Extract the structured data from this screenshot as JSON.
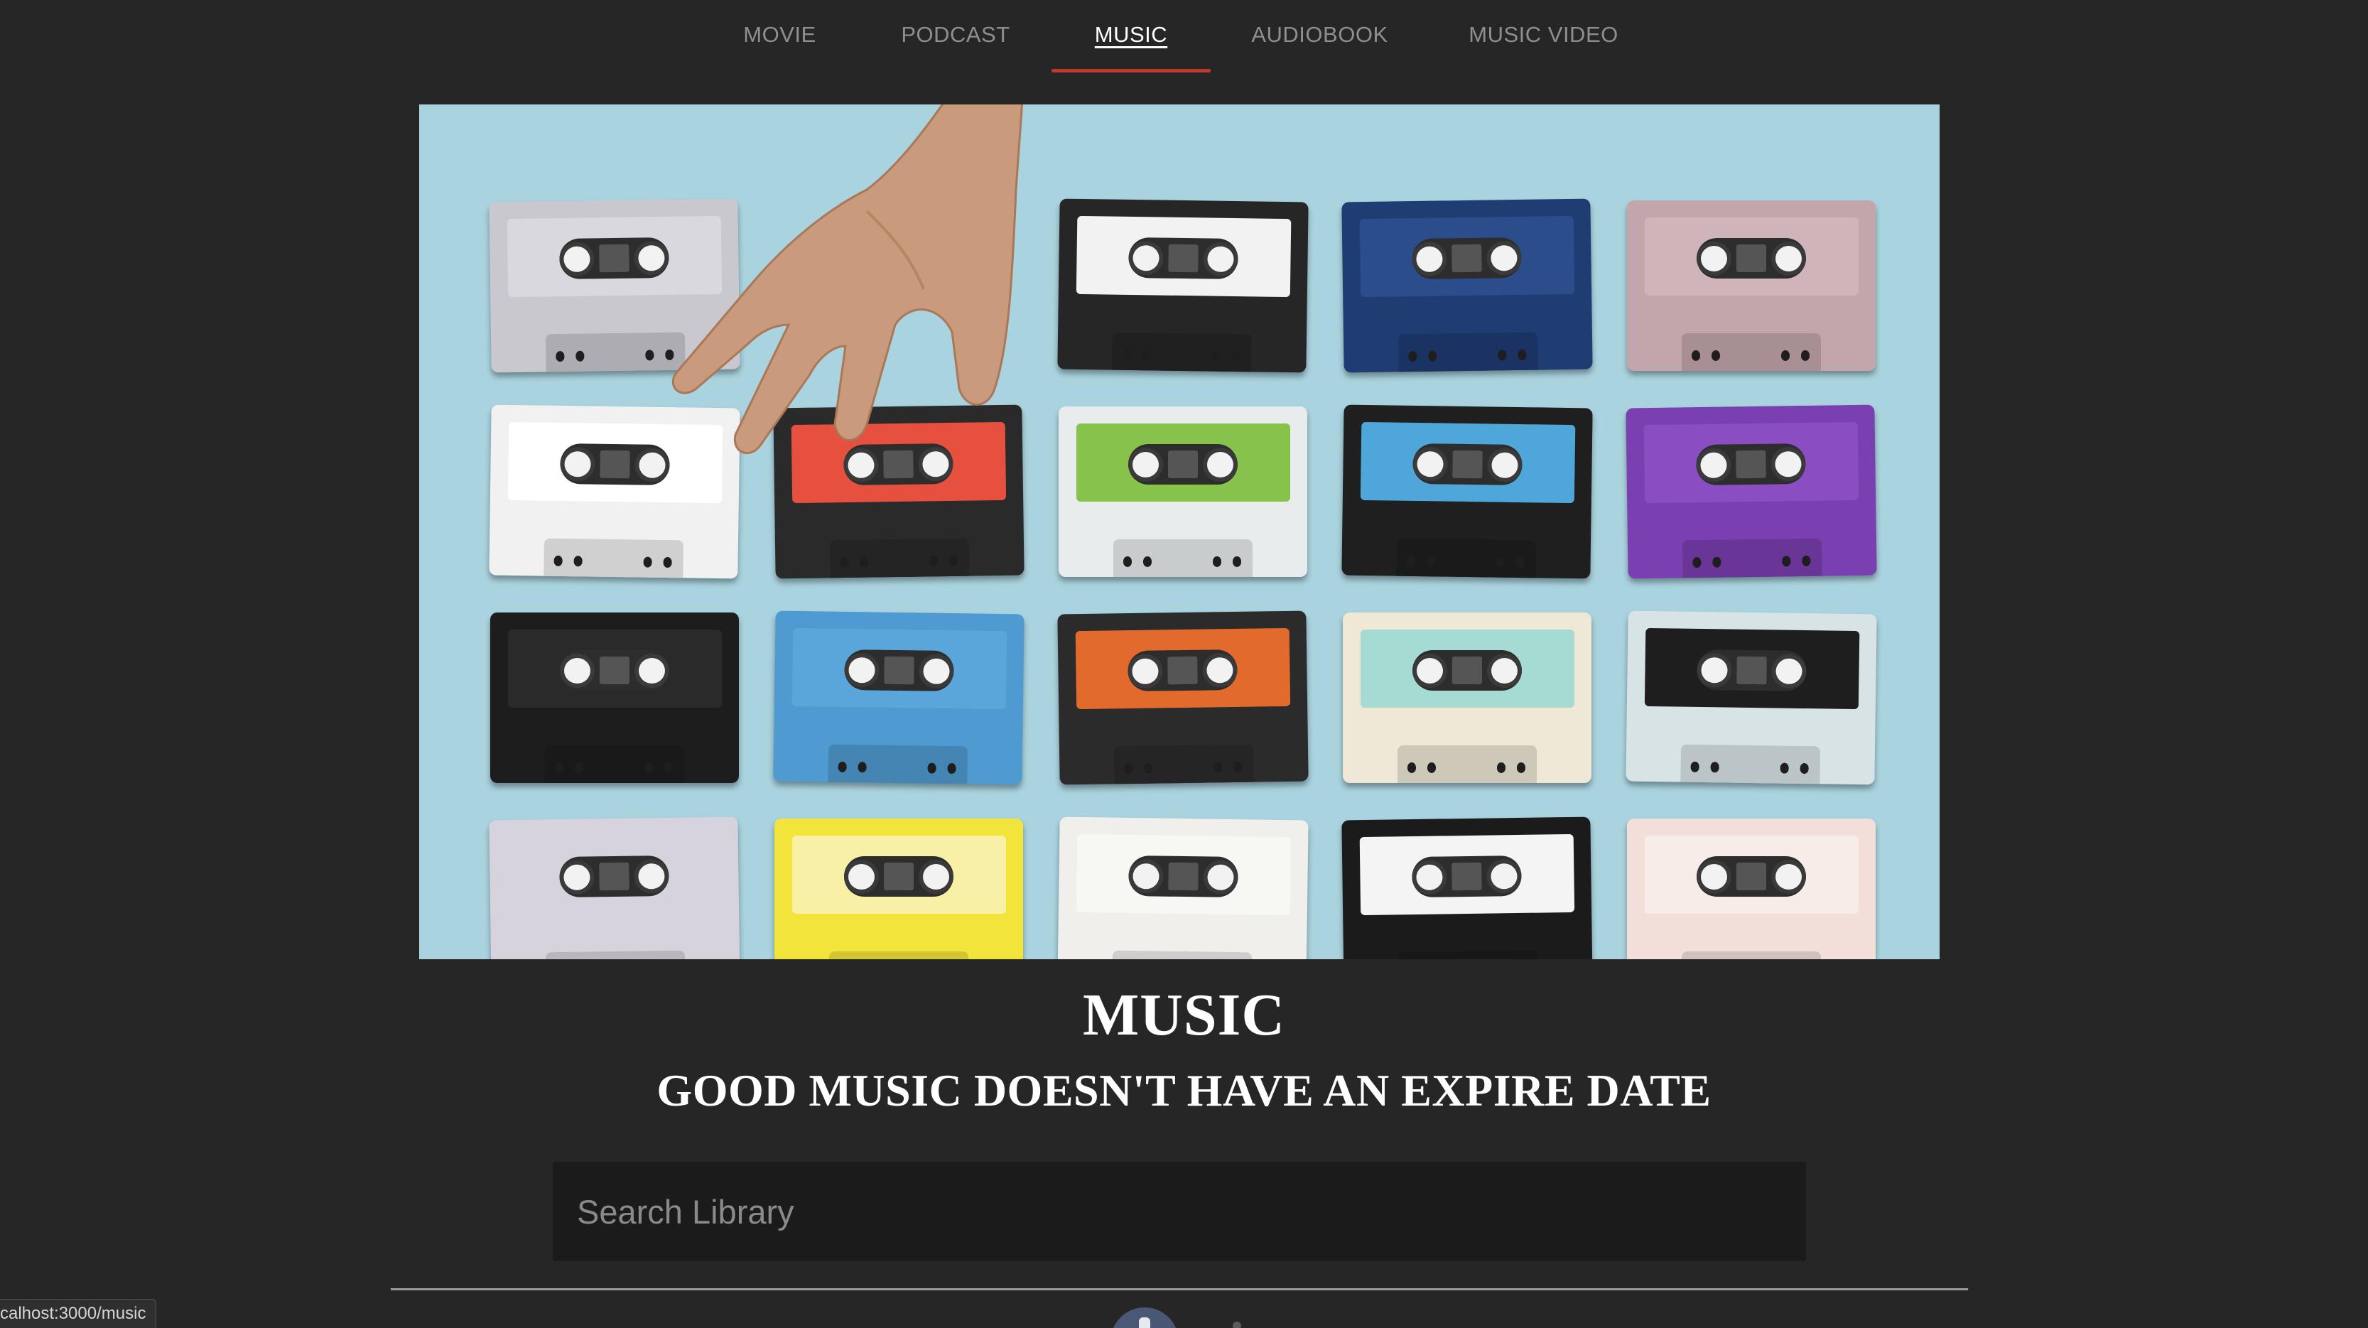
{
  "nav": {
    "tabs": [
      {
        "label": "MOVIE",
        "active": false
      },
      {
        "label": "PODCAST",
        "active": false
      },
      {
        "label": "MUSIC",
        "active": true
      },
      {
        "label": "AUDIOBOOK",
        "active": false
      },
      {
        "label": "MUSIC VIDEO",
        "active": false
      }
    ],
    "active_underline_color": "#c0392b"
  },
  "hero": {
    "image_subject": "cassette-tapes-collage",
    "background_color": "#a9d3df"
  },
  "heading": {
    "title": "MUSIC",
    "subtitle": "GOOD MUSIC DOESN'T HAVE AN EXPIRE DATE"
  },
  "search": {
    "placeholder": "Search Library",
    "value": ""
  },
  "status_bar": {
    "url": "calhost:3000/music"
  },
  "colors": {
    "page_background": "#262626",
    "search_background": "#1b1b1b",
    "text": "#ffffff",
    "tab_inactive": "#8f8f8f"
  }
}
